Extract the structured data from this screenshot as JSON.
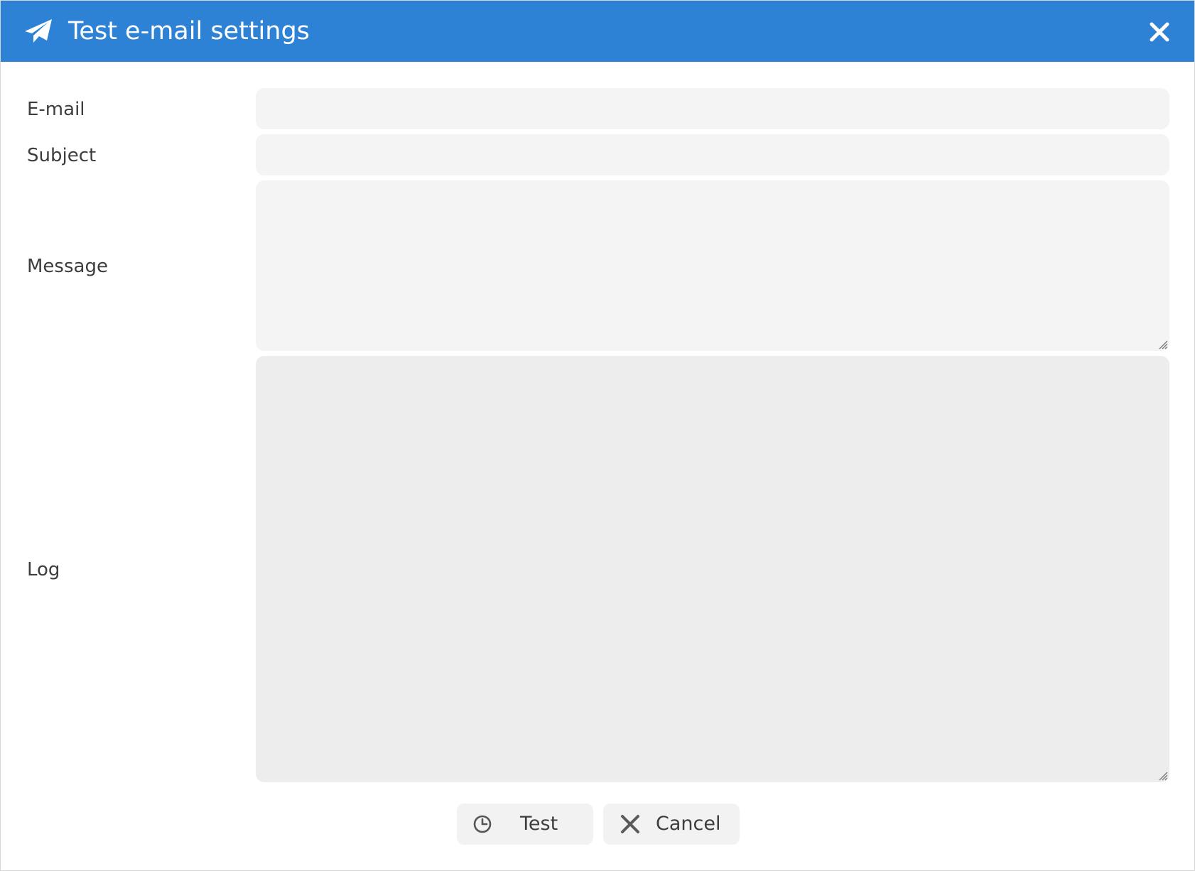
{
  "dialog": {
    "title": "Test e-mail settings",
    "title_icon": "paper-plane-icon",
    "close_icon": "close-icon",
    "header_color": "#2d82d5"
  },
  "form": {
    "email_label": "E-mail",
    "email_value": "",
    "subject_label": "Subject",
    "subject_value": "",
    "message_label": "Message",
    "message_value": "",
    "log_label": "Log",
    "log_value": ""
  },
  "buttons": {
    "test_label": "Test",
    "test_icon": "clock-icon",
    "cancel_label": "Cancel",
    "cancel_icon": "x-icon"
  }
}
